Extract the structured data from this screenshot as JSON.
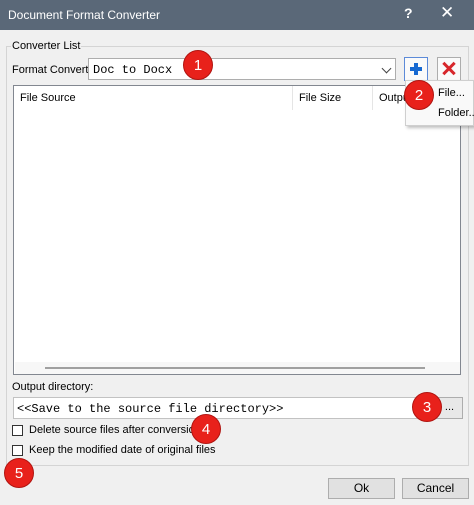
{
  "window": {
    "title": "Document Format Converter",
    "help_glyph": "?",
    "close_glyph": "✕"
  },
  "converter_list": {
    "group_label": "Converter List",
    "format_label": "Format Convert",
    "format_value": "Doc to Docx",
    "add_icon": "plus-icon",
    "remove_icon": "x-icon",
    "columns": [
      "File Source",
      "File Size",
      "Output"
    ],
    "add_menu": [
      "File...",
      "Folder..."
    ]
  },
  "output": {
    "label": "Output directory:",
    "value": "<<Save to the source file directory>>",
    "browse_label": "..."
  },
  "options": {
    "delete_source": {
      "label": "Delete source files after conversion",
      "checked": false
    },
    "keep_date": {
      "label": "Keep the modified date of original files",
      "checked": false
    }
  },
  "buttons": {
    "ok": "Ok",
    "cancel": "Cancel"
  },
  "annotations": [
    "1",
    "2",
    "3",
    "4",
    "5"
  ],
  "colors": {
    "annotation": "#e8211b",
    "add": "#1769d1",
    "remove": "#d7262b",
    "titlebar": "#5a6878"
  }
}
